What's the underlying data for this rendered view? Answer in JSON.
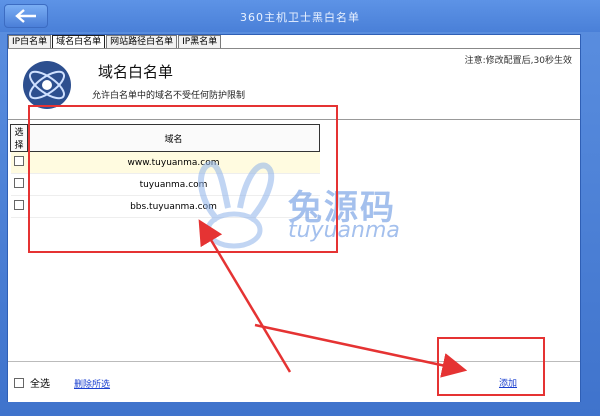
{
  "window": {
    "title": "360主机卫士黑白名单"
  },
  "tabs": [
    {
      "label": "IP白名单",
      "active": false
    },
    {
      "label": "域名白名单",
      "active": true
    },
    {
      "label": "网站路径白名单",
      "active": false
    },
    {
      "label": "IP黑名单",
      "active": false
    }
  ],
  "tip": "注意:修改配置后,30秒生效",
  "header": {
    "title": "域名白名单",
    "subtitle": "允许白名单中的域名不受任何防护限制"
  },
  "table": {
    "headers": [
      "选择",
      "域名"
    ],
    "rows": [
      {
        "domain": "www.tuyuanma.com",
        "highlighted": true
      },
      {
        "domain": "tuyuanma.com",
        "highlighted": false
      },
      {
        "domain": "bbs.tuyuanma.com",
        "highlighted": false
      }
    ]
  },
  "footer": {
    "select_all": "全选",
    "delete_selected": "删除所选",
    "add": "添加"
  },
  "watermark": {
    "cn": "兔源码",
    "en": "tuyuanma"
  },
  "colors": {
    "annotation": "#e53333",
    "titlebar": "#4a80d8",
    "link": "#1a3fcf"
  }
}
